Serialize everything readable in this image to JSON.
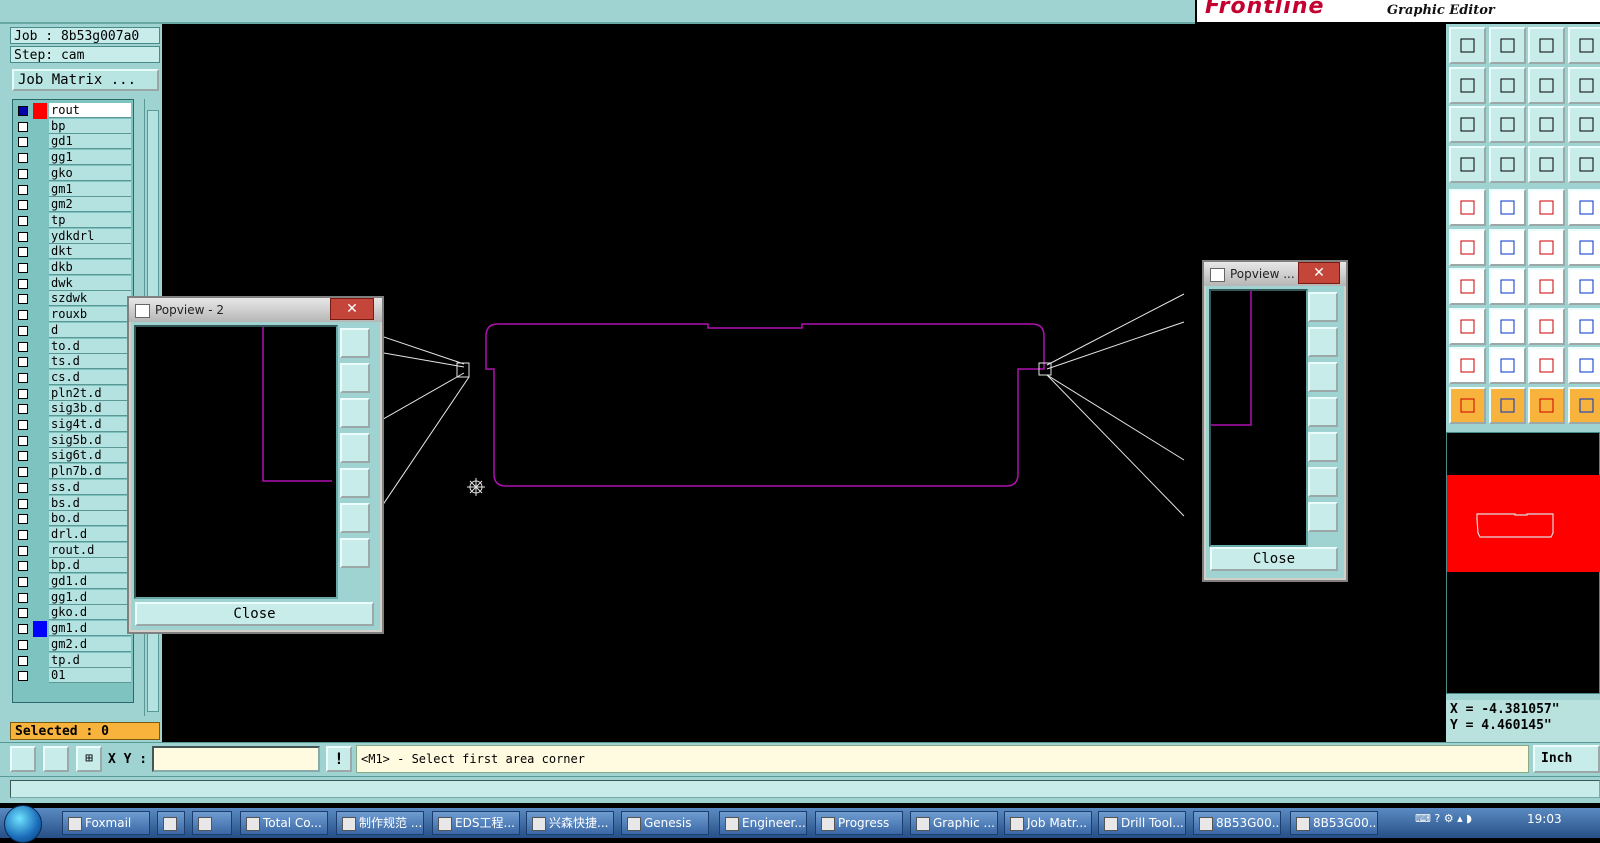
{
  "brand": {
    "logo": "Frontline",
    "subtitle": "Graphic Editor"
  },
  "left_panel": {
    "job": "Job : 8b53g007a0",
    "step": "Step: cam",
    "job_matrix_button": "Job Matrix ...",
    "selected": "Selected : 0",
    "layers": [
      {
        "name": "rout",
        "color": "#ff0000",
        "active": true
      },
      {
        "name": "bp"
      },
      {
        "name": "gd1"
      },
      {
        "name": "gg1"
      },
      {
        "name": "gko"
      },
      {
        "name": "gm1"
      },
      {
        "name": "gm2"
      },
      {
        "name": "tp"
      },
      {
        "name": "ydkdrl"
      },
      {
        "name": "dkt"
      },
      {
        "name": "dkb"
      },
      {
        "name": "dwk"
      },
      {
        "name": "szdwk"
      },
      {
        "name": "rouxb"
      },
      {
        "name": "d"
      },
      {
        "name": "to.d"
      },
      {
        "name": "ts.d"
      },
      {
        "name": "cs.d"
      },
      {
        "name": "pln2t.d"
      },
      {
        "name": "sig3b.d"
      },
      {
        "name": "sig4t.d"
      },
      {
        "name": "sig5b.d"
      },
      {
        "name": "sig6t.d"
      },
      {
        "name": "pln7b.d"
      },
      {
        "name": "ss.d"
      },
      {
        "name": "bs.d"
      },
      {
        "name": "bo.d"
      },
      {
        "name": "drl.d"
      },
      {
        "name": "rout.d"
      },
      {
        "name": "bp.d"
      },
      {
        "name": "gd1.d"
      },
      {
        "name": "gg1.d"
      },
      {
        "name": "gko.d"
      },
      {
        "name": "gm1.d",
        "color": "#0000ff"
      },
      {
        "name": "gm2.d"
      },
      {
        "name": "tp.d"
      },
      {
        "name": "01"
      }
    ]
  },
  "command_bar": {
    "xy_label": "X Y :",
    "xy_value": "",
    "warn": "!",
    "prompt": "<M1> - Select first area corner",
    "units": "Inch"
  },
  "coords": {
    "x": "X = -4.381057\"",
    "y": "Y = 4.460145\""
  },
  "popview_left": {
    "title": "Popview - 2",
    "close": "Close",
    "x_btn": "✕"
  },
  "popview_right": {
    "title": "Popview ...",
    "close": "Close",
    "x_btn": "✕"
  },
  "taskbar": {
    "items": [
      "Foxmail",
      "",
      "",
      "Total Co...",
      "制作规范 ...",
      "EDS工程...",
      "兴森快捷...",
      "Genesis",
      "Engineer...",
      "Progress",
      "Graphic ...",
      "Job Matr...",
      "Drill Tool...",
      "8B53G00...",
      "8B53G00..."
    ],
    "clock": "19:03"
  },
  "colors": {
    "teal": "#9fd3d2",
    "outline": "#b010b0",
    "selected": "#f7b33b",
    "red": "#ff0000"
  }
}
